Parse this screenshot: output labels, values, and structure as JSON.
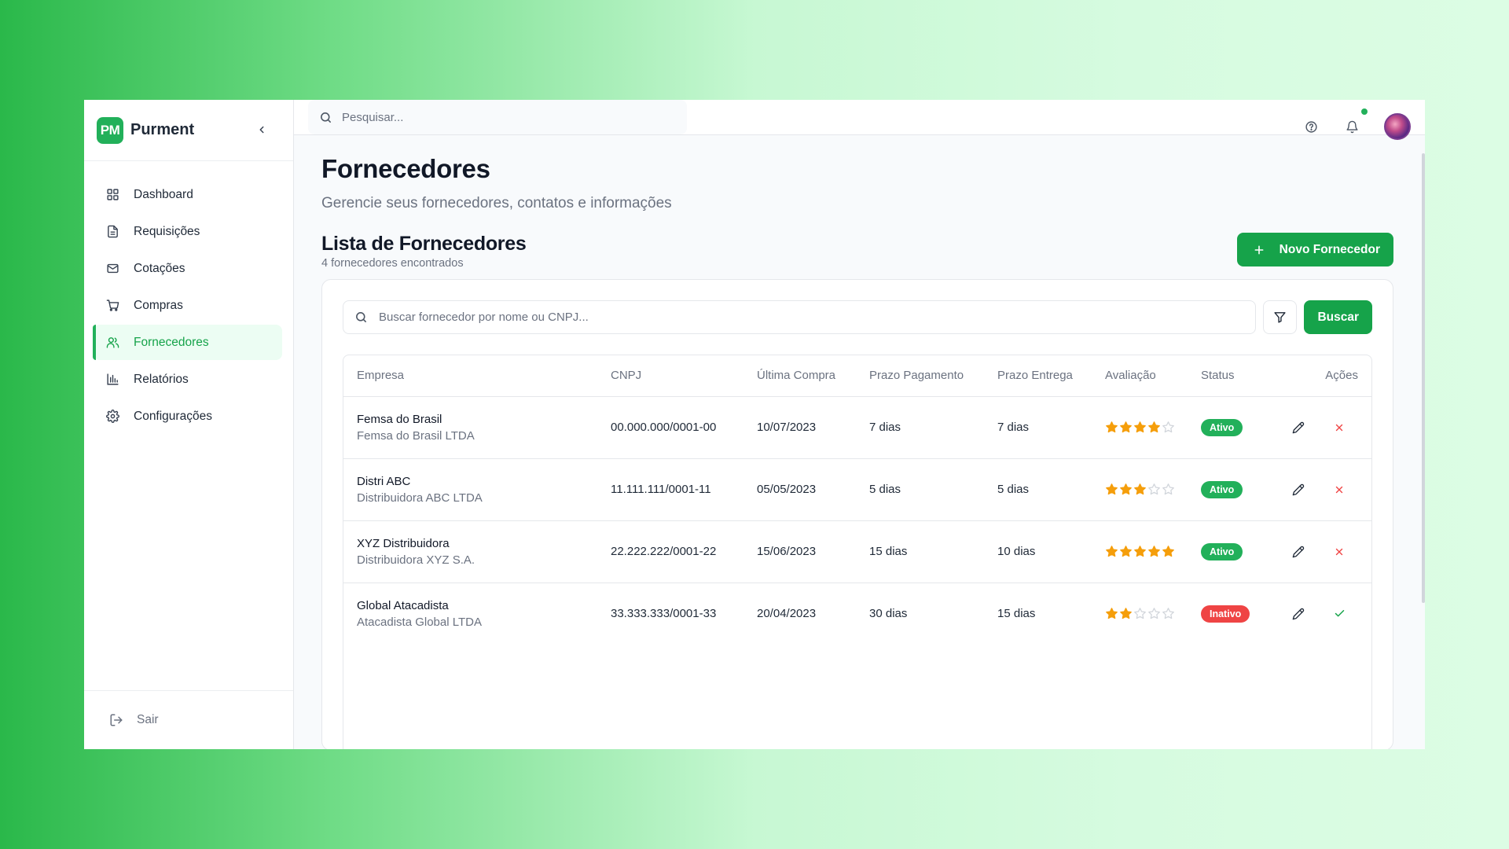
{
  "app": {
    "logo_text": "PM",
    "name": "Purment"
  },
  "sidebar": {
    "items": [
      {
        "label": "Dashboard",
        "icon": "grid-icon",
        "active": false
      },
      {
        "label": "Requisições",
        "icon": "document-icon",
        "active": false
      },
      {
        "label": "Cotações",
        "icon": "mail-icon",
        "active": false
      },
      {
        "label": "Compras",
        "icon": "cart-icon",
        "active": false
      },
      {
        "label": "Fornecedores",
        "icon": "users-icon",
        "active": true
      },
      {
        "label": "Relatórios",
        "icon": "bar-chart-icon",
        "active": false
      },
      {
        "label": "Configurações",
        "icon": "gear-icon",
        "active": false
      }
    ],
    "logout_label": "Sair"
  },
  "topbar": {
    "search_placeholder": "Pesquisar..."
  },
  "page": {
    "title": "Fornecedores",
    "subtitle": "Gerencie seus fornecedores, contatos e informações",
    "list_title": "Lista de Fornecedores",
    "list_count": "4 fornecedores encontrados",
    "new_button": "Novo Fornecedor",
    "search_placeholder": "Buscar fornecedor por nome ou CNPJ...",
    "search_button": "Buscar"
  },
  "table": {
    "columns": [
      "Empresa",
      "CNPJ",
      "Última Compra",
      "Prazo Pagamento",
      "Prazo Entrega",
      "Avaliação",
      "Status",
      "Ações"
    ],
    "rows": [
      {
        "name": "Femsa do Brasil",
        "legal": "Femsa do Brasil LTDA",
        "cnpj": "00.000.000/0001-00",
        "last": "10/07/2023",
        "pay": "7 dias",
        "delivery": "7 dias",
        "rating": 4,
        "status": "Ativo",
        "status_type": "ativo",
        "toggle_action": "deactivate"
      },
      {
        "name": "Distri ABC",
        "legal": "Distribuidora ABC LTDA",
        "cnpj": "11.111.111/0001-11",
        "last": "05/05/2023",
        "pay": "5 dias",
        "delivery": "5 dias",
        "rating": 3,
        "status": "Ativo",
        "status_type": "ativo",
        "toggle_action": "deactivate"
      },
      {
        "name": "XYZ Distribuidora",
        "legal": "Distribuidora XYZ S.A.",
        "cnpj": "22.222.222/0001-22",
        "last": "15/06/2023",
        "pay": "15 dias",
        "delivery": "10 dias",
        "rating": 5,
        "status": "Ativo",
        "status_type": "ativo",
        "toggle_action": "deactivate"
      },
      {
        "name": "Global Atacadista",
        "legal": "Atacadista Global LTDA",
        "cnpj": "33.333.333/0001-33",
        "last": "20/04/2023",
        "pay": "30 dias",
        "delivery": "15 dias",
        "rating": 2,
        "status": "Inativo",
        "status_type": "inativo",
        "toggle_action": "activate"
      }
    ],
    "max_rating": 5
  },
  "colors": {
    "brand": "#22b05a",
    "primary_button": "#16a34a",
    "star_filled": "#f59e0b",
    "star_empty": "#d1d5db",
    "danger": "#ef4444"
  }
}
